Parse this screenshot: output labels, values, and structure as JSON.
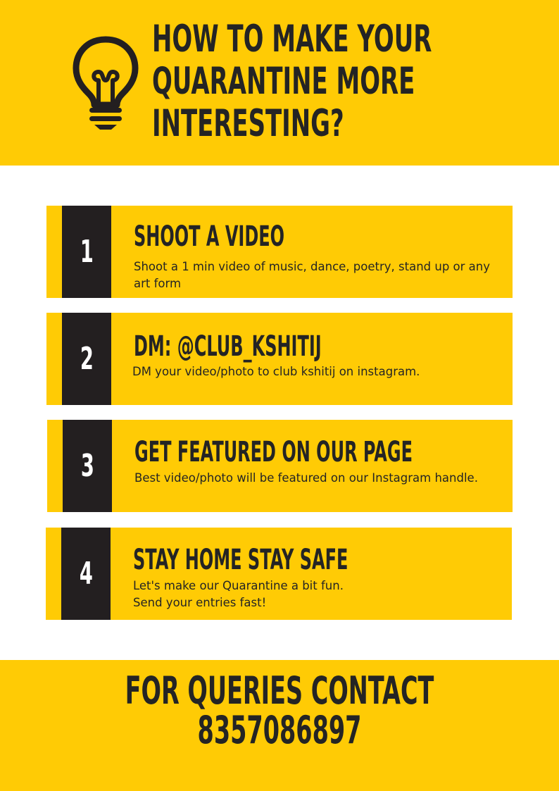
{
  "header": {
    "icon": "lightbulb-icon",
    "title_lines": [
      "HOW TO MAKE YOUR",
      "QUARANTINE MORE",
      "INTERESTING?"
    ]
  },
  "steps": [
    {
      "number": "1",
      "title": "SHOOT A VIDEO",
      "description": "Shoot a 1 min video of music, dance,  poetry, stand up or any art form"
    },
    {
      "number": "2",
      "title": "DM: @CLUB_KSHITIJ",
      "description": "DM your video/photo to club kshitij on instagram."
    },
    {
      "number": "3",
      "title": "GET FEATURED ON OUR PAGE",
      "description": "Best video/photo will be featured on our Instagram handle."
    },
    {
      "number": "4",
      "title": "STAY HOME STAY SAFE",
      "description_lines": [
        "Let's make our Quarantine a bit fun.",
        "Send your entries fast!"
      ]
    }
  ],
  "footer": {
    "contact_label": "FOR QUERIES CONTACT",
    "phone": "8357086897"
  },
  "colors": {
    "accent": "#ffcb05",
    "dark": "#231f20",
    "background": "#ffffff"
  }
}
